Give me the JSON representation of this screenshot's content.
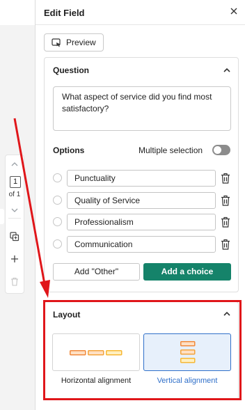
{
  "page_nav": {
    "page_number": "1",
    "of_label": "of 1"
  },
  "panel": {
    "title": "Edit Field",
    "preview_label": "Preview"
  },
  "question_section": {
    "title": "Question",
    "question_text": "What aspect of service did you find most satisfactory?",
    "options_label": "Options",
    "multiple_selection_label": "Multiple selection",
    "multiple_selection_enabled": false,
    "options": [
      {
        "label": "Punctuality"
      },
      {
        "label": "Quality of Service"
      },
      {
        "label": "Professionalism"
      },
      {
        "label": "Communication"
      }
    ],
    "add_other_label": "Add \"Other\"",
    "add_choice_label": "Add a choice"
  },
  "layout_section": {
    "title": "Layout",
    "choices": [
      {
        "label": "Horizontal alignment",
        "selected": false
      },
      {
        "label": "Vertical alignment",
        "selected": true
      }
    ]
  },
  "colors": {
    "accent_green": "#15836a",
    "annotation_red": "#e0161a",
    "selected_blue": "#2f6fc9",
    "layout_orange": "#f08a3c"
  }
}
